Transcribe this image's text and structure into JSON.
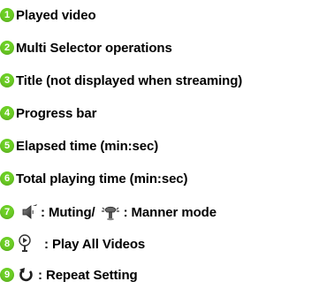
{
  "colors": {
    "badge_green": "#6ccf25",
    "text": "#000000"
  },
  "items": [
    {
      "num": "1",
      "label": "Played video"
    },
    {
      "num": "2",
      "label": "Multi Selector operations"
    },
    {
      "num": "3",
      "label": "Title (not displayed when streaming)"
    },
    {
      "num": "4",
      "label": "Progress bar"
    },
    {
      "num": "5",
      "label": "Elapsed time (min:sec)"
    },
    {
      "num": "6",
      "label": "Total playing time (min:sec)"
    },
    {
      "num": "7",
      "label_a": ": Muting/",
      "label_b": ": Manner mode",
      "icon_a": "speaker-muted-icon",
      "icon_b": "manner-mode-icon"
    },
    {
      "num": "8",
      "label": ": Play All Videos",
      "icon": "play-all-videos-icon"
    },
    {
      "num": "9",
      "label": ": Repeat Setting",
      "icon": "repeat-icon"
    }
  ]
}
